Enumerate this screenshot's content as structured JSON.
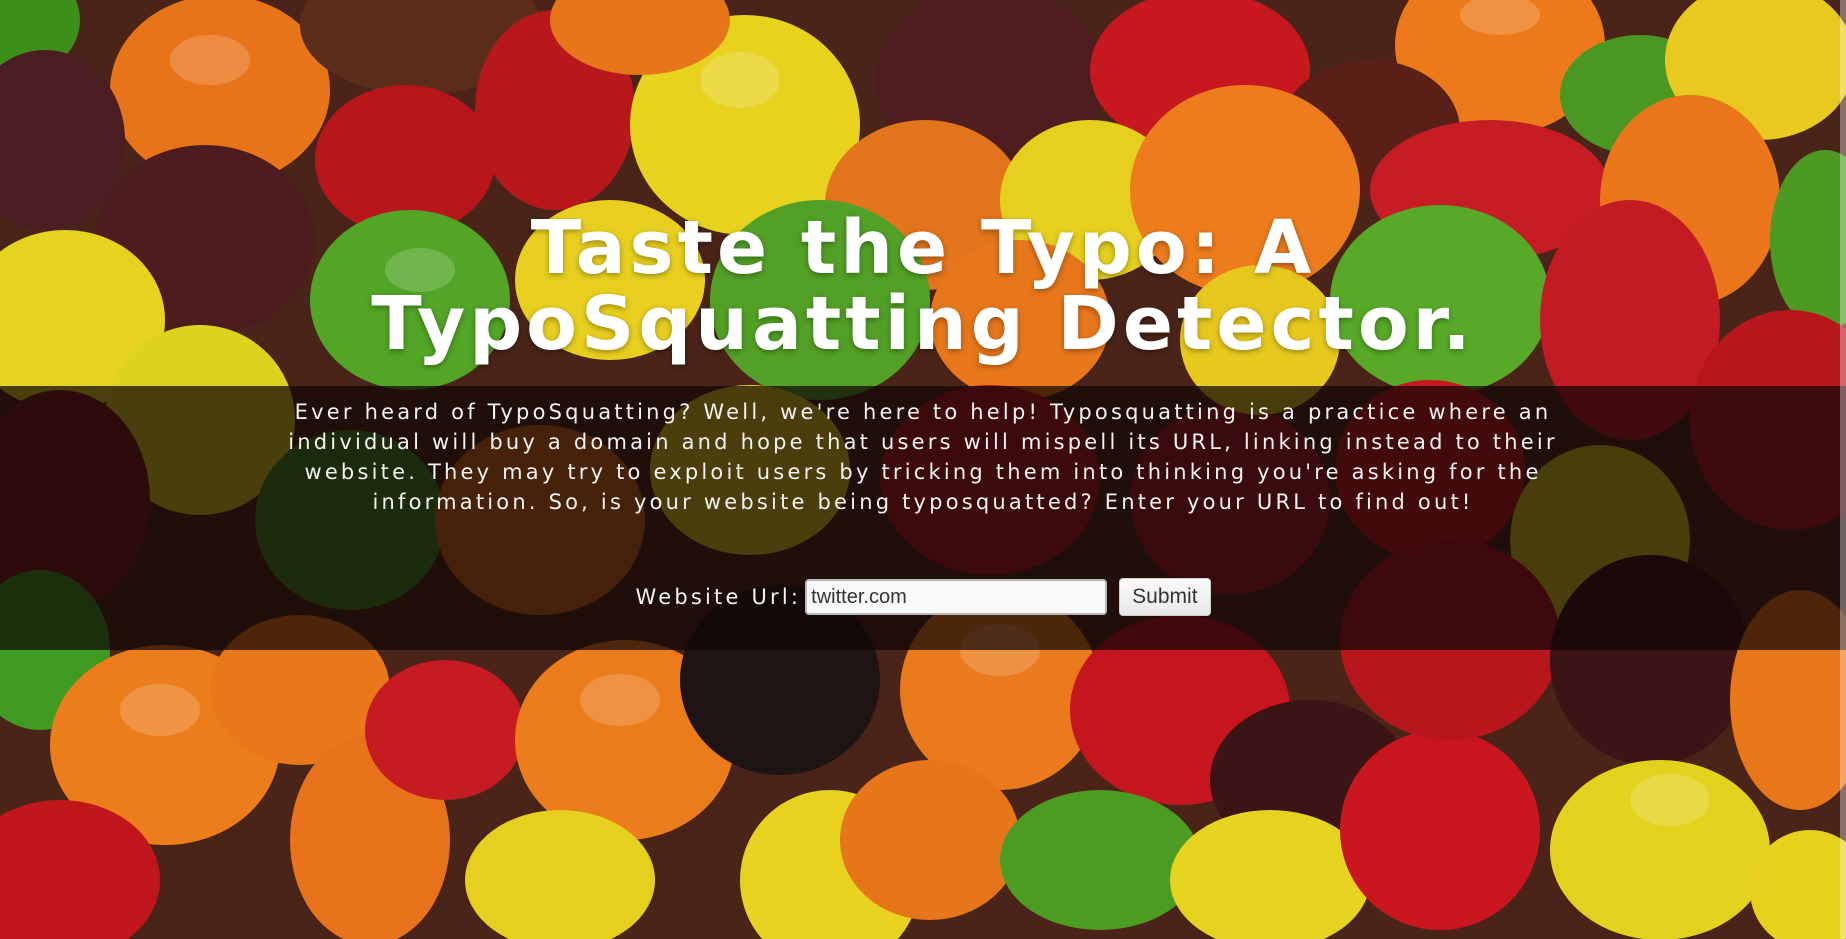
{
  "hero": {
    "title_line1": "Taste the Typo: A",
    "title_line2": "TypoSquatting Detector."
  },
  "description": {
    "text": "Ever heard of TypoSquatting? Well, we're here to help! Typosquatting is a practice where an individual will buy a domain and hope that users will mispell its URL, linking instead to their website. They may try to exploit users by tricking them into thinking you're asking for the information. So, is your website being typosquatted? Enter your URL to find out!"
  },
  "form": {
    "label": "Website Url:",
    "input_value": "twitter.com",
    "submit_label": "Submit"
  },
  "colors": {
    "band": "#0f0505",
    "title": "#ffffff",
    "text": "#f2f2f2"
  },
  "background": {
    "subject": "candy-background-image"
  }
}
